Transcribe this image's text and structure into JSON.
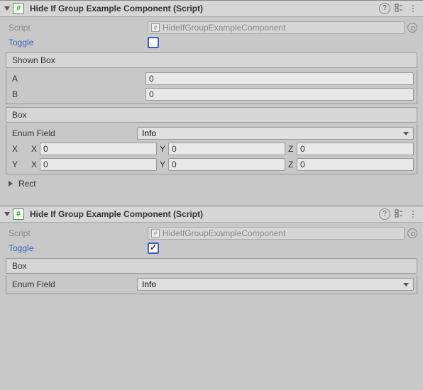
{
  "c1": {
    "title": "Hide If Group Example Component (Script)",
    "script_label": "Script",
    "script_name": "HideIfGroupExampleComponent",
    "toggle_label": "Toggle",
    "toggle_checked": false,
    "shown_box_title": "Shown Box",
    "a_label": "A",
    "a_value": "0",
    "b_label": "B",
    "b_value": "0",
    "box_title": "Box",
    "enum_label": "Enum Field",
    "enum_value": "Info",
    "x_label": "X",
    "y_label": "Y",
    "vx": {
      "xl": "X",
      "xv": "0",
      "yl": "Y",
      "yv": "0",
      "zl": "Z",
      "zv": "0"
    },
    "vy": {
      "xl": "X",
      "xv": "0",
      "yl": "Y",
      "yv": "0",
      "zl": "Z",
      "zv": "0"
    },
    "rect_label": "Rect"
  },
  "c2": {
    "title": "Hide If Group Example Component (Script)",
    "script_label": "Script",
    "script_name": "HideIfGroupExampleComponent",
    "toggle_label": "Toggle",
    "toggle_checked": true,
    "box_title": "Box",
    "enum_label": "Enum Field",
    "enum_value": "Info"
  },
  "icons": {
    "cs": "#",
    "help": "?",
    "preset": "⚙",
    "menu": "⋮"
  }
}
